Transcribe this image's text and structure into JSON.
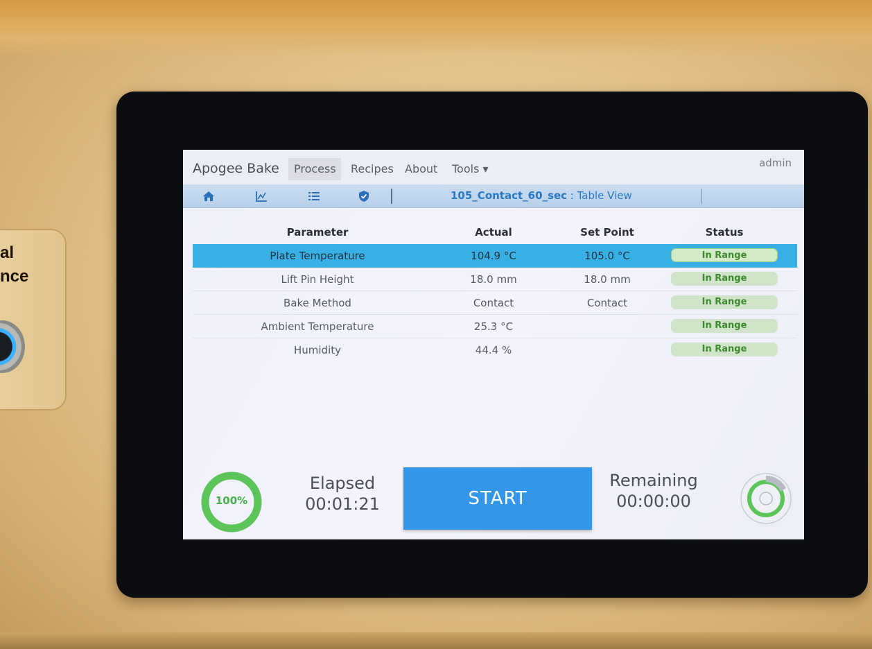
{
  "side_panel": {
    "text_lines": "al\nnce"
  },
  "menu": {
    "brand": "Apogee Bake",
    "items": [
      "Process",
      "Recipes",
      "About",
      "Tools ▾"
    ],
    "user": "admin"
  },
  "toolbar": {
    "icons": [
      "home-icon",
      "chart-icon",
      "list-icon",
      "shield-check-icon"
    ],
    "recipe_name": "105_Contact_60_sec",
    "view_separator": " : ",
    "view_name": "Table View"
  },
  "table": {
    "headers": {
      "parameter": "Parameter",
      "actual": "Actual",
      "set_point": "Set Point",
      "status": "Status"
    },
    "rows": [
      {
        "parameter": "Plate Temperature",
        "actual": "104.9 °C",
        "set_point": "105.0 °C",
        "status": "In Range",
        "selected": true
      },
      {
        "parameter": "Lift Pin Height",
        "actual": "18.0 mm",
        "set_point": "18.0 mm",
        "status": "In Range"
      },
      {
        "parameter": "Bake Method",
        "actual": "Contact",
        "set_point": "Contact",
        "status": "In Range"
      },
      {
        "parameter": "Ambient Temperature",
        "actual": "25.3 °C",
        "set_point": "",
        "status": "In Range"
      },
      {
        "parameter": "Humidity",
        "actual": "44.4 %",
        "set_point": "",
        "status": "In Range"
      }
    ]
  },
  "progress": {
    "label": "100%",
    "value": 1.0
  },
  "elapsed": {
    "label": "Elapsed",
    "value": "00:01:21"
  },
  "start_button": {
    "label": "START"
  },
  "remaining": {
    "label": "Remaining",
    "value": "00:00:00"
  },
  "colors": {
    "accent_blue": "#3396e6",
    "selected_row": "#39b0e4",
    "status_green": "#3e8a2e",
    "progress_green": "#5cc55a",
    "recipe_blue": "#2a78c2"
  }
}
